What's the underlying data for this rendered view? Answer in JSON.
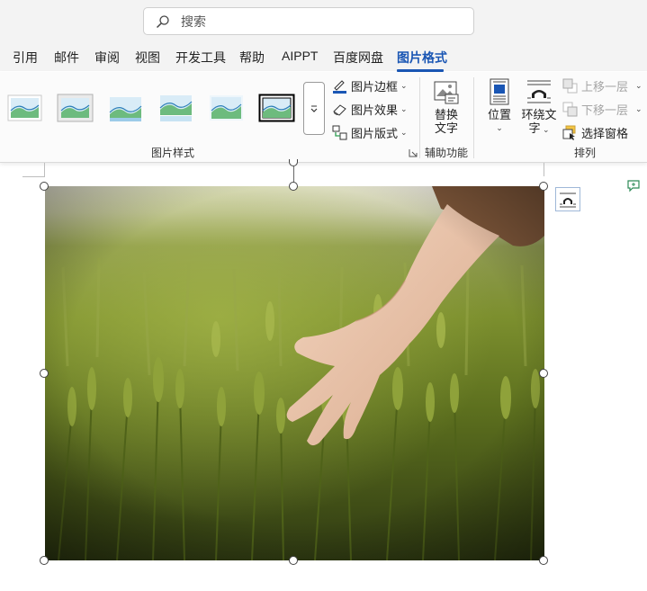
{
  "search": {
    "placeholder": "搜索"
  },
  "tabs": [
    {
      "label": "引用"
    },
    {
      "label": "邮件"
    },
    {
      "label": "审阅"
    },
    {
      "label": "视图"
    },
    {
      "label": "开发工具"
    },
    {
      "label": "帮助"
    },
    {
      "label": "AIPPT"
    },
    {
      "label": "百度网盘"
    },
    {
      "label": "图片格式",
      "active": true
    }
  ],
  "ribbon": {
    "picture_styles": {
      "group_label": "图片样式",
      "border_label": "图片边框",
      "effects_label": "图片效果",
      "layout_label": "图片版式"
    },
    "accessibility": {
      "group_label": "辅助功能",
      "alt_text_line1": "替换",
      "alt_text_line2": "文字"
    },
    "arrange": {
      "group_label": "排列",
      "position_label": "位置",
      "wrap_line1": "环绕文",
      "wrap_line2": "字",
      "bring_forward_label": "上移一层",
      "send_backward_label": "下移一层",
      "selection_pane_label": "选择窗格"
    }
  },
  "colors": {
    "accent": "#1a56b4",
    "ribbon_bg": "#fbfbfb",
    "titlebar_bg": "#f3f3f3"
  }
}
